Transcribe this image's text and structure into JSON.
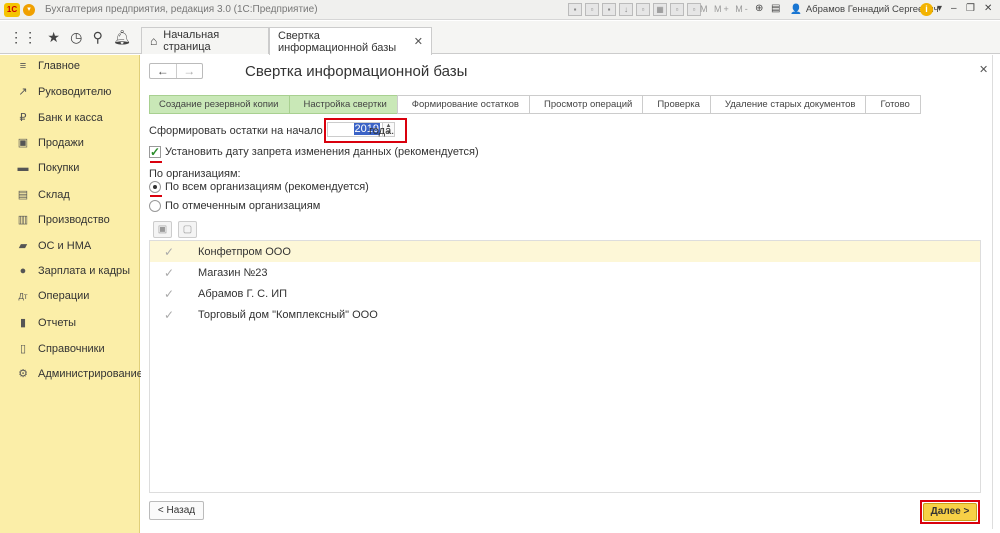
{
  "titlebar": {
    "logo": "1С",
    "app_title": "Бухгалтерия предприятия, редакция 3.0  (1С:Предприятие)",
    "memory_buttons": "M M+ M-",
    "user": "Абрамов Геннадий Сергеевич"
  },
  "tabs": [
    {
      "label": "Начальная страница"
    },
    {
      "label": "Свертка информационной базы"
    }
  ],
  "sidebar": {
    "items": [
      {
        "label": "Главное",
        "icon": "menu-icon"
      },
      {
        "label": "Руководителю",
        "icon": "trend-icon"
      },
      {
        "label": "Банк и касса",
        "icon": "ruble-icon"
      },
      {
        "label": "Продажи",
        "icon": "cart-icon"
      },
      {
        "label": "Покупки",
        "icon": "basket-icon"
      },
      {
        "label": "Склад",
        "icon": "box-icon"
      },
      {
        "label": "Производство",
        "icon": "factory-icon"
      },
      {
        "label": "ОС и НМА",
        "icon": "truck-icon"
      },
      {
        "label": "Зарплата и кадры",
        "icon": "person-icon"
      },
      {
        "label": "Операции",
        "icon": "dt-kt-icon"
      },
      {
        "label": "Отчеты",
        "icon": "chart-icon"
      },
      {
        "label": "Справочники",
        "icon": "book-icon"
      },
      {
        "label": "Администрирование",
        "icon": "gear-icon"
      }
    ]
  },
  "form": {
    "title": "Свертка информационной базы",
    "steps": [
      {
        "label": "Создание резервной копии",
        "done": true
      },
      {
        "label": "Настройка свертки",
        "done": true
      },
      {
        "label": "Формирование остатков",
        "done": false
      },
      {
        "label": "Просмотр операций",
        "done": false
      },
      {
        "label": "Проверка",
        "done": false
      },
      {
        "label": "Удаление старых документов",
        "done": false
      },
      {
        "label": "Готово",
        "done": false
      }
    ],
    "balances_label": "Сформировать остатки на начало",
    "year": "2019",
    "year_suffix": "года.",
    "lock_date_checkbox": "Установить дату запрета изменения данных (рекомендуется)",
    "lock_date_checked": true,
    "org_group_label": "По организациям:",
    "radio_all": "По всем организациям (рекомендуется)",
    "radio_selected": "По отмеченным организациям",
    "organizations": [
      "Конфетпром ООО",
      "Магазин №23",
      "Абрамов Г. С. ИП",
      "Торговый дом \"Комплексный\" ООО"
    ],
    "back_button": "< Назад",
    "next_button": "Далее >"
  }
}
